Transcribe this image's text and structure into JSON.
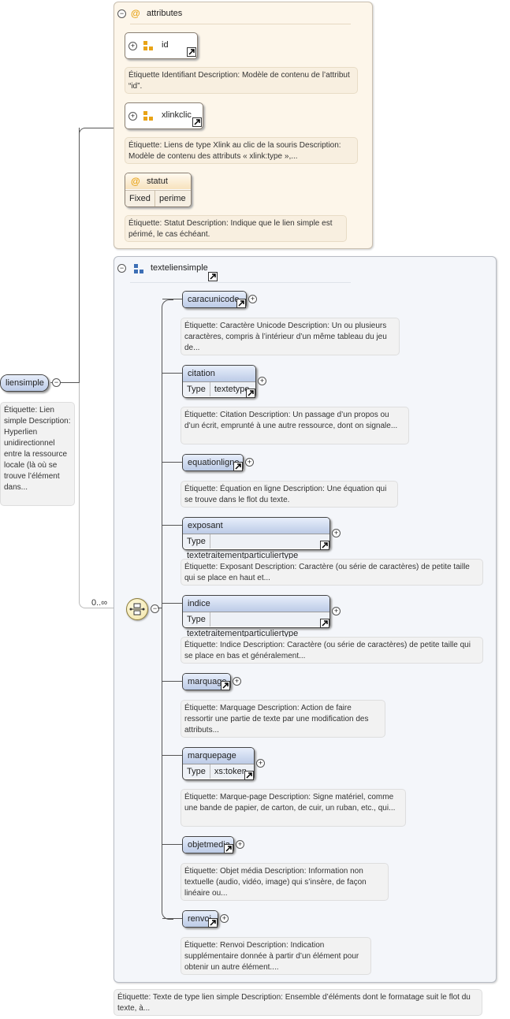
{
  "root": {
    "name": "liensimple",
    "desc": "Étiquette: Lien simple Description: Hyperlien unidirectionnel entre la ressource locale (là où se trouve l’élément dans..."
  },
  "attributes": {
    "label": "attributes",
    "id": {
      "name": "id",
      "desc": "Étiquette Identifiant Description: Modèle de contenu de l’attribut “id”."
    },
    "xlinkclic": {
      "name": "xlinkclic",
      "desc": "Étiquette: Liens de type Xlink au clic de la souris Description: Modèle de contenu des attributs « xlink:type »,..."
    },
    "statut": {
      "name": "statut",
      "fixed_key": "Fixed",
      "fixed_value": "perime",
      "desc": "Étiquette: Statut Description: Indique que le lien simple est périmé, le cas échéant."
    }
  },
  "group": {
    "name": "texteliensimple",
    "cardinality": "0..∞",
    "desc": "Étiquette: Texte de type lien simple Description: Ensemble d’éléments dont le formatage suit le flot du texte, à..."
  },
  "children": [
    {
      "name": "caracunicode",
      "desc": "Étiquette: Caractère Unicode Description: Un ou plusieurs caractères, compris à l’intérieur d’un même tableau du jeu de..."
    },
    {
      "name": "citation",
      "type_key": "Type",
      "type_value": "textetype",
      "desc": "Étiquette: Citation Description: Un passage d’un propos ou d’un écrit, emprunté à une autre ressource, dont on signale..."
    },
    {
      "name": "equationligne",
      "desc": "Étiquette: Équation en ligne Description: Une équation qui se trouve dans le flot du texte."
    },
    {
      "name": "exposant",
      "type_key": "Type",
      "type_value": "textetraitementparticuliertype",
      "desc": "Étiquette: Exposant Description: Caractère (ou série de caractères) de petite taille qui se place en haut et..."
    },
    {
      "name": "indice",
      "type_key": "Type",
      "type_value": "textetraitementparticuliertype",
      "desc": "Étiquette: Indice Description: Caractère (ou série de caractères) de petite taille qui se place en bas et généralement..."
    },
    {
      "name": "marquage",
      "desc": "Étiquette: Marquage Description: Action de faire ressortir une partie de texte par une modification des attributs..."
    },
    {
      "name": "marquepage",
      "type_key": "Type",
      "type_value": "xs:token",
      "desc": "Étiquette: Marque-page Description: Signe matériel, comme une bande de papier, de carton, de cuir, un ruban, etc., qui..."
    },
    {
      "name": "objetmedia",
      "desc": "Étiquette: Objet média Description: Information non textuelle (audio, vidéo, image) qui s’insère, de façon linéaire ou..."
    },
    {
      "name": "renvoi",
      "desc": "Étiquette: Renvoi Description: Indication supplémentaire donnée à partir d’un élément pour obtenir un autre élément...."
    }
  ],
  "icons": {
    "collapse": "minus-circle-icon",
    "expand": "plus-circle-icon",
    "attribute": "at-sign-icon",
    "attribute_group": "attribute-group-icon",
    "reference": "reference-arrow-icon",
    "sequence": "sequence-compositor-icon"
  },
  "colors": {
    "element_header": "#bccbe7",
    "attribute_panel": "#fdf6ea",
    "group_panel": "#f4f6fa",
    "attr_icon": "#e8a317",
    "group_icon": "#3d6fb5"
  }
}
